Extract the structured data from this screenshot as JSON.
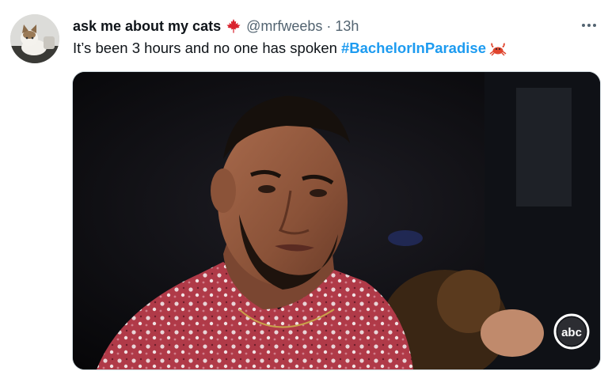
{
  "tweet": {
    "author_name": "ask me about my cats",
    "handle": "@mrfweebs",
    "separator": "·",
    "timestamp": "13h",
    "body_text": "It’s been 3 hours and no one has spoken",
    "hashtag": "#BachelorInParadise",
    "more_icon": "more-horizontal-icon",
    "avatar": "cat-avatar",
    "name_emoji": "maple-leaf-icon",
    "hashtag_emoji": "crab-icon",
    "media_watermark": "abc",
    "colors": {
      "link": "#1d9bf0",
      "secondary_text": "#536471",
      "primary_text": "#0f1419"
    }
  }
}
